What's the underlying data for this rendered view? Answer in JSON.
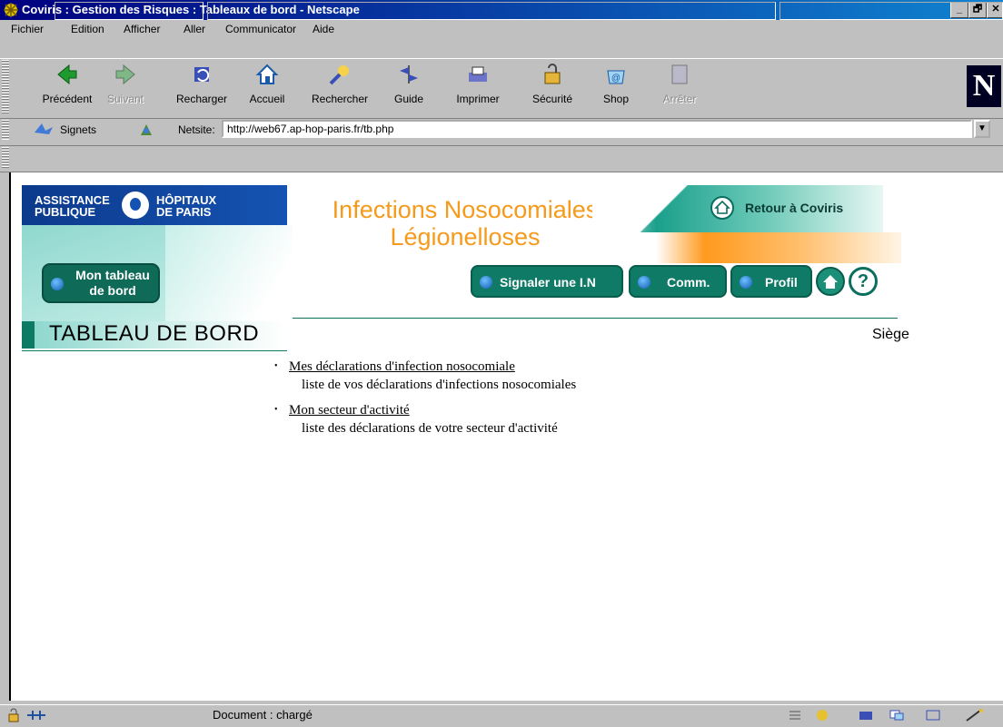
{
  "window": {
    "title": "Coviris : Gestion des Risques : Tableaux de bord - Netscape",
    "controls": [
      "_",
      "🗗",
      "✕"
    ]
  },
  "menu": [
    "Fichier",
    "Edition",
    "Afficher",
    "Aller",
    "Communicator",
    "Aide"
  ],
  "toolbar": {
    "buttons": [
      {
        "label": "Précédent",
        "icon": "back-arrow-icon",
        "enabled": true
      },
      {
        "label": "Suivant",
        "icon": "forward-arrow-icon",
        "enabled": false
      },
      {
        "label": "Recharger",
        "icon": "reload-icon",
        "enabled": true
      },
      {
        "label": "Accueil",
        "icon": "home-icon",
        "enabled": true
      },
      {
        "label": "Rechercher",
        "icon": "search-icon",
        "enabled": true
      },
      {
        "label": "Guide",
        "icon": "guide-icon",
        "enabled": true
      },
      {
        "label": "Imprimer",
        "icon": "print-icon",
        "enabled": true
      },
      {
        "label": "Sécurité",
        "icon": "padlock-icon",
        "enabled": true
      },
      {
        "label": "Shop",
        "icon": "shop-icon",
        "enabled": true
      },
      {
        "label": "Arrêter",
        "icon": "stop-icon",
        "enabled": false
      }
    ],
    "logo": "N"
  },
  "location": {
    "bookmarks_label": "Signets",
    "netsite_label": "Netsite:",
    "url": "http://web67.ap-hop-paris.fr/tb.php"
  },
  "page": {
    "org_left": [
      "ASSISTANCE",
      "PUBLIQUE"
    ],
    "org_right": [
      "HÔPITAUX",
      "DE  PARIS"
    ],
    "app_title_line1": "Infections Nosocomiales",
    "app_title_line2": "Légionelloses",
    "retour": "Retour à Coviris",
    "nav": {
      "mon_tableau_l1": "Mon tableau",
      "mon_tableau_l2": "de bord",
      "signaler": "Signaler une I.N",
      "comm": "Comm.",
      "profil": "Profil",
      "help": "?"
    },
    "section_title": "TABLEAU DE BORD",
    "location_label": "Siège",
    "links": [
      {
        "title": "Mes déclarations d'infection nosocomiale",
        "desc": "liste de vos déclarations d'infections nosocomiales"
      },
      {
        "title": "Mon secteur d'activité",
        "desc": "liste des déclarations de votre secteur d'activité"
      }
    ]
  },
  "status": {
    "text": "Document : chargé"
  },
  "colors": {
    "title_orange": "#f59a1a",
    "teal": "#0f7a66",
    "aphp_blue": "#1553b2"
  }
}
